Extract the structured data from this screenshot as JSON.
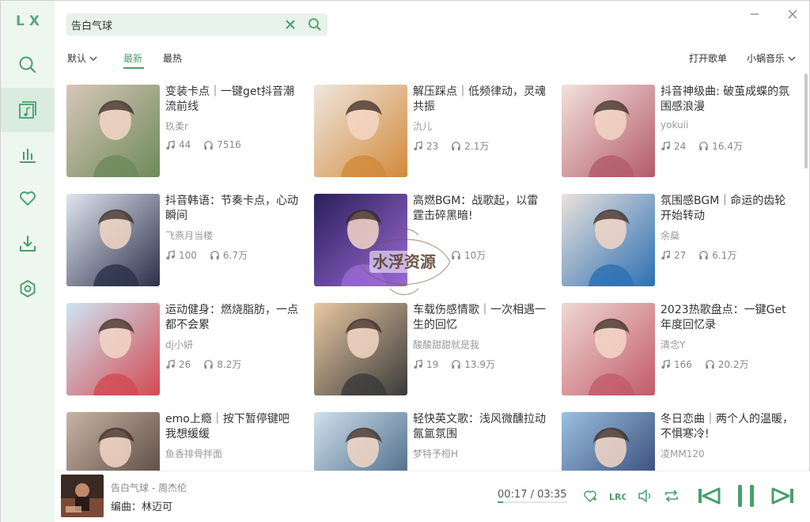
{
  "app": {
    "logo": "LX"
  },
  "sidebar": {
    "items": [
      {
        "name": "search",
        "icon": "search-icon"
      },
      {
        "name": "song-list",
        "icon": "song-list-icon",
        "active": true
      },
      {
        "name": "leaderboard",
        "icon": "leaderboard-icon"
      },
      {
        "name": "favorites",
        "icon": "heart-icon"
      },
      {
        "name": "download",
        "icon": "download-icon"
      },
      {
        "name": "settings",
        "icon": "settings-icon"
      }
    ]
  },
  "search": {
    "value": "告白气球",
    "placeholder": ""
  },
  "toolbar": {
    "sort": "默认",
    "tabs": [
      {
        "label": "最新",
        "active": true
      },
      {
        "label": "最热",
        "active": false
      }
    ],
    "open_list": "打开歌单",
    "source": "小蜗音乐"
  },
  "playlists": [
    {
      "title": "变装卡点｜一键get抖音潮流前线",
      "author": "玖柔r",
      "songs": "44",
      "plays": "7516",
      "colors": [
        "#d8c6b8",
        "#6d8a5a"
      ]
    },
    {
      "title": "解压踩点｜低频律动，灵魂共振",
      "author": "氿儿",
      "songs": "23",
      "plays": "2.1万",
      "colors": [
        "#efe6df",
        "#d28a3a"
      ]
    },
    {
      "title": "抖音神级曲: 破茧成蝶的氛围感浪漫",
      "author": "yokuii",
      "songs": "24",
      "plays": "16.4万",
      "colors": [
        "#f3e2dc",
        "#b35a6a"
      ]
    },
    {
      "title": "抖音韩语：节奏卡点，心动瞬间",
      "author": "飞燕月当楼",
      "songs": "100",
      "plays": "6.7万",
      "colors": [
        "#dfe6ef",
        "#2b2f4a"
      ]
    },
    {
      "title": "高燃BGM：战歌起，以雷霆击碎黑暗!",
      "author": "",
      "songs": "",
      "plays": "10万",
      "colors": [
        "#2a1f5a",
        "#9a6ad6"
      ]
    },
    {
      "title": "氛围感BGM｜命运的齿轮开始转动",
      "author": "余燊",
      "songs": "27",
      "plays": "6.1万",
      "colors": [
        "#e9e2dc",
        "#2c6fb2"
      ]
    },
    {
      "title": "运动健身：燃烧脂肪，一点都不会累",
      "author": "dj小妍",
      "songs": "26",
      "plays": "8.2万",
      "colors": [
        "#cfe4f2",
        "#d24a52"
      ]
    },
    {
      "title": "车载伤感情歌｜一次相遇一生的回忆",
      "author": "酸酸甜甜就是我",
      "songs": "19",
      "plays": "13.9万",
      "colors": [
        "#e8c8a2",
        "#3a3a3a"
      ]
    },
    {
      "title": "2023热歌盘点：一键Get年度回忆录",
      "author": "清念Y",
      "songs": "166",
      "plays": "20.2万",
      "colors": [
        "#f0d8d2",
        "#c25a6a"
      ]
    },
    {
      "title": "emo上瘾｜按下暂停键吧我想缓缓",
      "author": "鱼香排骨拌面",
      "songs": "",
      "plays": "",
      "colors": [
        "#c8b4a4",
        "#4a3a34"
      ]
    },
    {
      "title": "轻快英文歌：浅风微醺拉动氤氲氛围",
      "author": "梦特予桓H",
      "songs": "",
      "plays": "",
      "colors": [
        "#cfe0ec",
        "#3a5a7a"
      ]
    },
    {
      "title": "冬日恋曲｜两个人的温暖，不惧寒冷!",
      "author": "凌MM120",
      "songs": "",
      "plays": "",
      "colors": [
        "#9ac0e0",
        "#2a3a6a"
      ]
    }
  ],
  "player": {
    "title": "告白气球 - 周杰伦",
    "subtitle": "编曲：林迈可",
    "time": "00:17 / 03:35",
    "progress": 0.08
  },
  "watermark": {
    "text": "水浮资源"
  },
  "colors": {
    "accent": "#4a9e6b",
    "sidebar_bg": "#eef6f0"
  }
}
